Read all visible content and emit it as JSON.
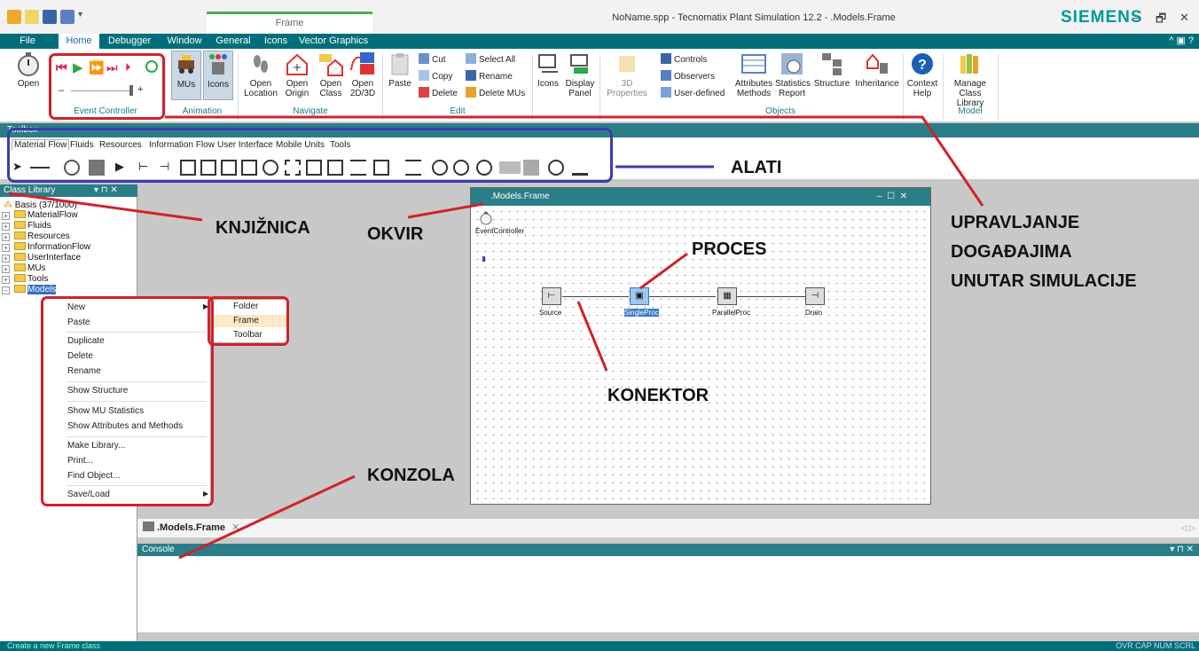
{
  "window": {
    "title": "NoName.spp - Tecnomatix Plant Simulation 12.2 - .Models.Frame",
    "context_tab": "Frame",
    "brand": "SIEMENS",
    "min": "–",
    "max": "🗗",
    "close": "✕"
  },
  "ribbon_tabs": [
    "File",
    "Home",
    "Debugger",
    "Window",
    "General",
    "Icons",
    "Vector Graphics"
  ],
  "ribbon": {
    "open": "Open",
    "event_controller_label": "Event Controller",
    "minus": "–",
    "plus": "+",
    "mus": "MUs",
    "icons": "Icons",
    "animation_label": "Animation",
    "open_location": "Open\nLocation",
    "open_origin": "Open\nOrigin",
    "open_class": "Open\nClass",
    "open_2d3d": "Open\n2D/3D",
    "navigate_label": "Navigate",
    "paste": "Paste",
    "cut": "Cut",
    "copy": "Copy",
    "delete": "Delete",
    "select_all": "Select All",
    "rename": "Rename",
    "delete_mus": "Delete MUs",
    "edit_label": "Edit",
    "icons_btn": "Icons",
    "display_panel": "Display\nPanel",
    "properties_3d": "3D\nProperties",
    "controls": "Controls",
    "observers": "Observers",
    "user_defined": "User-defined",
    "attributes_methods": "Attributes\nMethods",
    "statistics_report": "Statistics\nReport",
    "structure": "Structure",
    "inheritance": "Inheritance",
    "context_help": "Context\nHelp",
    "objects_label": "Objects",
    "manage_class_library": "Manage\nClass Library",
    "model_label": "Model"
  },
  "toolbox": {
    "header": "Toolbox",
    "tabs": [
      "Material Flow",
      "Fluids",
      "Resources",
      "Information Flow",
      "User Interface",
      "Mobile Units",
      "Tools"
    ]
  },
  "class_library": {
    "header": "Class Library",
    "root": "Basis (37/1000)",
    "items": [
      "MaterialFlow",
      "Fluids",
      "Resources",
      "InformationFlow",
      "UserInterface",
      "MUs",
      "Tools",
      "Models"
    ]
  },
  "frame": {
    "title": ".Models.Frame",
    "event_controller": "EventController",
    "nodes": [
      "Source",
      "SingleProc",
      "ParallelProc",
      "Drain"
    ]
  },
  "context_menu": {
    "items": [
      "New",
      "Paste",
      "Duplicate",
      "Delete",
      "Rename",
      "Show Structure",
      "Show MU Statistics",
      "Show Attributes and Methods",
      "Make Library...",
      "Print...",
      "Find Object...",
      "Save/Load"
    ],
    "submenu": [
      "Folder",
      "Frame",
      "Toolbar"
    ]
  },
  "doc_tab": ".Models.Frame",
  "console": {
    "header": "Console"
  },
  "status": {
    "text": "Create a new Frame class",
    "right": "OVR  CAP  NUM  SCRL"
  },
  "annotations": {
    "alati": "ALATI",
    "knjiznica": "KNJIŽNICA",
    "okvir": "OKVIR",
    "proces": "PROCES",
    "konektor": "KONEKTOR",
    "konzola": "KONZOLA",
    "upravljanje_1": "UPRAVLJANJE",
    "upravljanje_2": "DOGAĐAJIMA",
    "upravljanje_3": "UNUTAR SIMULACIJE"
  },
  "colors": {
    "ribbon_teal": "#006e7a",
    "panel_header": "#2a7e87",
    "annotation_red": "#d0222c",
    "annotation_blue": "#3c3ca8"
  }
}
